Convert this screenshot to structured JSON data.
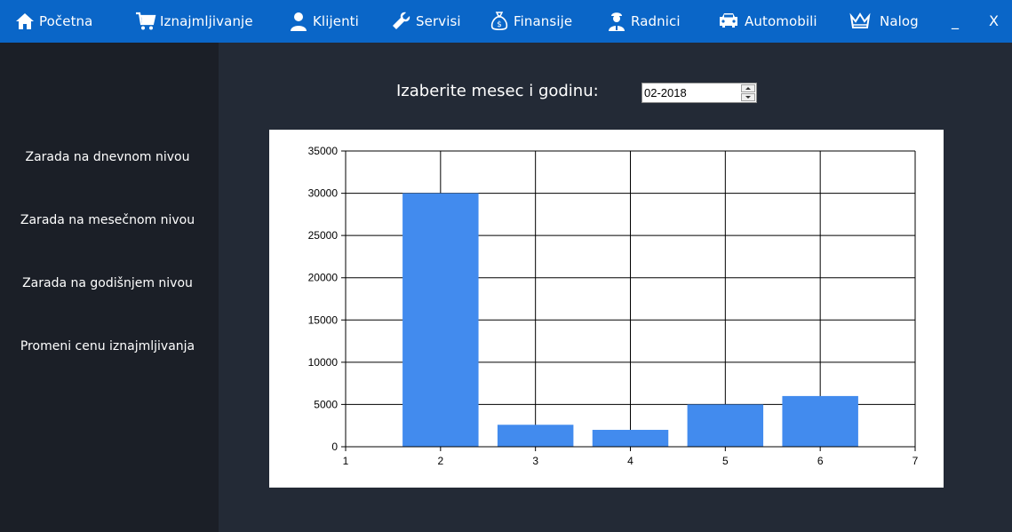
{
  "nav": {
    "items": [
      {
        "label": "Početna",
        "icon": "home-icon"
      },
      {
        "label": "Iznajmljivanje",
        "icon": "cart-icon"
      },
      {
        "label": "Klijenti",
        "icon": "user-icon"
      },
      {
        "label": "Servisi",
        "icon": "wrench-icon"
      },
      {
        "label": "Finansije",
        "icon": "money-bag-icon"
      },
      {
        "label": "Radnici",
        "icon": "worker-icon"
      },
      {
        "label": "Automobili",
        "icon": "car-icon"
      },
      {
        "label": "Nalog",
        "icon": "crown-icon"
      }
    ],
    "minimize_label": "_",
    "close_label": "X"
  },
  "sidebar": {
    "items": [
      {
        "label": "Zarada na dnevnom nivou"
      },
      {
        "label": "Zarada na mesečnom nivou"
      },
      {
        "label": "Zarada na godišnjem nivou"
      },
      {
        "label": "Promeni cenu iznajmljivanja"
      }
    ]
  },
  "main": {
    "picker_label": "Izaberite mesec i godinu:",
    "picker_value": "02-2018"
  },
  "colors": {
    "topbar": "#0a66c8",
    "bar": "#428bee"
  },
  "chart_data": {
    "type": "bar",
    "x": [
      2,
      3,
      4,
      5,
      6
    ],
    "values": [
      30000,
      2600,
      2000,
      5000,
      6000
    ],
    "xlim": [
      1,
      7
    ],
    "ylim": [
      0,
      35000
    ],
    "xticks": [
      1,
      2,
      3,
      4,
      5,
      6,
      7
    ],
    "yticks": [
      0,
      5000,
      10000,
      15000,
      20000,
      25000,
      30000,
      35000
    ],
    "grid": true,
    "title": "",
    "xlabel": "",
    "ylabel": ""
  }
}
